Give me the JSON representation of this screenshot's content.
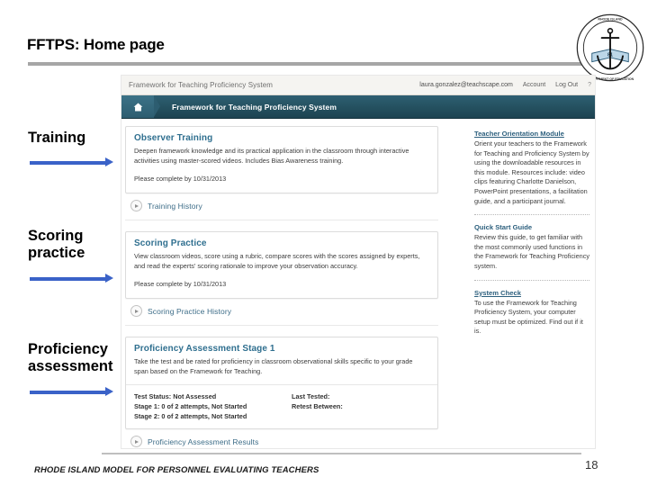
{
  "slide": {
    "title": "FFTPS: Home page",
    "footer": "RHODE ISLAND MODEL FOR PERSONNEL EVALUATING TEACHERS",
    "page_number": "18",
    "seal_alt": "rhode-island-state-seal",
    "accent_arrow_color": "#3a62c8",
    "rule_color": "#a6a6a6"
  },
  "annotations": [
    {
      "label": "Training"
    },
    {
      "label": "Scoring\npractice"
    },
    {
      "label": "Proficiency\nassessment"
    }
  ],
  "app": {
    "topbar": {
      "brand": "Framework for Teaching Proficiency System",
      "email": "laura.gonzalez@teachscape.com",
      "account_label": "Account",
      "logout_label": "Log Out",
      "help_label": "?"
    },
    "nav": {
      "home_icon": "home-icon",
      "title": "Framework for Teaching Proficiency System",
      "bar_color": "#24505f"
    },
    "panels": [
      {
        "title": "Observer Training",
        "description": "Deepen framework knowledge and its practical application in the classroom through interactive activities using master-scored videos. Includes Bias Awareness training.",
        "due": "Please complete by 10/31/2013",
        "footer_link": "Training History"
      },
      {
        "title": "Scoring Practice",
        "description": "View classroom videos, score using a rubric, compare scores with the scores assigned by experts, and read the experts' scoring rationale to improve your observation accuracy.",
        "due": "Please complete by 10/31/2013",
        "footer_link": "Scoring Practice History"
      },
      {
        "title": "Proficiency Assessment Stage 1",
        "description": "Take the test and be rated for proficiency in classroom observational skills specific to your grade span based on the Framework for Teaching.",
        "status_left": "Test Status: Not Assessed\nStage 1: 0 of 2 attempts, Not Started\nStage 2: 0 of 2 attempts, Not Started",
        "status_right": "Last Tested:\nRetest Between:",
        "footer_link": "Proficiency Assessment Results"
      }
    ],
    "sidebar": [
      {
        "title": "Teacher Orientation Module",
        "text": "Orient your teachers to the Framework for Teaching and Proficiency System by using the downloadable resources in this module. Resources include: video clips featuring Charlotte Danielson, PowerPoint presentations, a facilitation guide, and a participant journal."
      },
      {
        "title": "Quick Start Guide",
        "text": "Review this guide, to get familiar with the most commonly used functions in the Framework for Teaching Proficiency system."
      },
      {
        "title": "System Check",
        "text": "To use the Framework for Teaching Proficiency System, your computer setup must be optimized. Find out if it is."
      }
    ]
  }
}
